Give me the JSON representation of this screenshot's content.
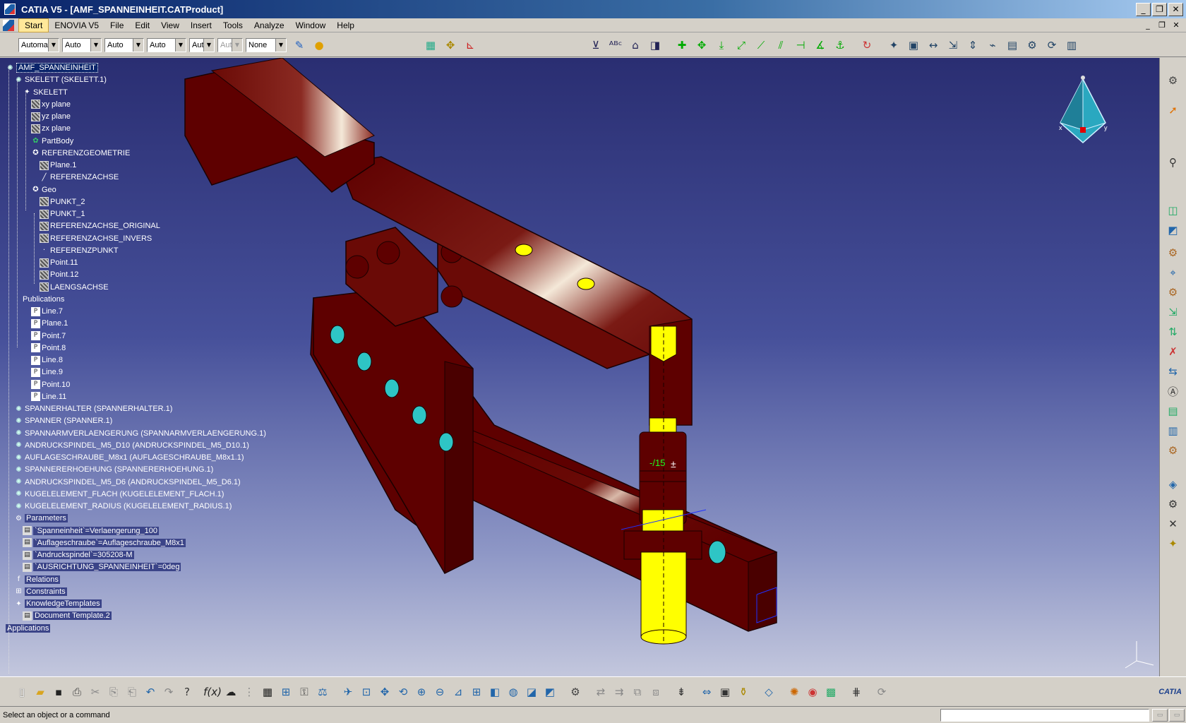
{
  "window": {
    "title": "CATIA V5 - [AMF_SPANNEINHEIT.CATProduct]",
    "minimize": "_",
    "restore": "❐",
    "close": "✕"
  },
  "menu": {
    "items": [
      "Start",
      "ENOVIA V5",
      "File",
      "Edit",
      "View",
      "Insert",
      "Tools",
      "Analyze",
      "Window",
      "Help"
    ],
    "active": "Start"
  },
  "toolbar_top": {
    "combos": [
      {
        "value": "Automa",
        "disabled": false
      },
      {
        "value": "Auto",
        "disabled": false
      },
      {
        "value": "Auto",
        "disabled": false
      },
      {
        "value": "Auto",
        "disabled": false
      },
      {
        "value": "Aut",
        "disabled": false
      },
      {
        "value": "Aut",
        "disabled": true
      },
      {
        "value": "None",
        "disabled": false
      }
    ]
  },
  "tree": {
    "nodes": [
      {
        "label": "AMF_SPANNEINHEIT",
        "level": 0,
        "icon": "product-icon",
        "style": "hl"
      },
      {
        "label": "SKELETT (SKELETT.1)",
        "level": 1,
        "icon": "product-icon"
      },
      {
        "label": "SKELETT",
        "level": 2,
        "icon": "part-icon"
      },
      {
        "label": "xy plane",
        "level": 3,
        "icon": "plane-icon"
      },
      {
        "label": "yz plane",
        "level": 3,
        "icon": "plane-icon"
      },
      {
        "label": "zx plane",
        "level": 3,
        "icon": "plane-icon"
      },
      {
        "label": "PartBody",
        "level": 3,
        "icon": "body-icon"
      },
      {
        "label": "REFERENZGEOMETRIE",
        "level": 3,
        "icon": "geoset-icon"
      },
      {
        "label": "Plane.1",
        "level": 4,
        "icon": "plane-icon"
      },
      {
        "label": "REFERENZACHSE",
        "level": 4,
        "icon": "line-icon"
      },
      {
        "label": "Geo",
        "level": 3,
        "icon": "geoset-icon"
      },
      {
        "label": "PUNKT_2",
        "level": 4,
        "icon": "plane-icon"
      },
      {
        "label": "PUNKT_1",
        "level": 4,
        "icon": "plane-icon"
      },
      {
        "label": "REFERENZACHSE_ORIGINAL",
        "level": 4,
        "icon": "plane-icon"
      },
      {
        "label": "REFERENZACHSE_INVERS",
        "level": 4,
        "icon": "plane-icon"
      },
      {
        "label": "REFERENZPUNKT",
        "level": 4,
        "icon": "point-icon"
      },
      {
        "label": "Point.11",
        "level": 4,
        "icon": "plane-icon"
      },
      {
        "label": "Point.12",
        "level": 4,
        "icon": "plane-icon"
      },
      {
        "label": "LAENGSACHSE",
        "level": 4,
        "icon": "plane-icon"
      },
      {
        "label": "Publications",
        "level": 2,
        "icon": "none"
      },
      {
        "label": "Line.7",
        "level": 3,
        "icon": "publication-icon"
      },
      {
        "label": "Plane.1",
        "level": 3,
        "icon": "publication-icon"
      },
      {
        "label": "Point.7",
        "level": 3,
        "icon": "publication-icon"
      },
      {
        "label": "Point.8",
        "level": 3,
        "icon": "publication-icon"
      },
      {
        "label": "Line.8",
        "level": 3,
        "icon": "publication-icon"
      },
      {
        "label": "Line.9",
        "level": 3,
        "icon": "publication-icon"
      },
      {
        "label": "Point.10",
        "level": 3,
        "icon": "publication-icon"
      },
      {
        "label": "Line.11",
        "level": 3,
        "icon": "publication-icon"
      },
      {
        "label": "SPANNERHALTER (SPANNERHALTER.1)",
        "level": 1,
        "icon": "product-icon"
      },
      {
        "label": "SPANNER (SPANNER.1)",
        "level": 1,
        "icon": "product-icon"
      },
      {
        "label": "SPANNARMVERLAENGERUNG (SPANNARMVERLAENGERUNG.1)",
        "level": 1,
        "icon": "product-icon"
      },
      {
        "label": "ANDRUCKSPINDEL_M5_D10 (ANDRUCKSPINDEL_M5_D10.1)",
        "level": 1,
        "icon": "product-icon"
      },
      {
        "label": "AUFLAGESCHRAUBE_M8x1 (AUFLAGESCHRAUBE_M8x1.1)",
        "level": 1,
        "icon": "product-icon"
      },
      {
        "label": "SPANNERERHOEHUNG (SPANNERERHOEHUNG.1)",
        "level": 1,
        "icon": "product-icon"
      },
      {
        "label": "ANDRUCKSPINDEL_M5_D6 (ANDRUCKSPINDEL_M5_D6.1)",
        "level": 1,
        "icon": "product-icon"
      },
      {
        "label": "KUGELELEMENT_FLACH (KUGELELEMENT_FLACH.1)",
        "level": 1,
        "icon": "product-icon"
      },
      {
        "label": "KUGELELEMENT_RADIUS (KUGELELEMENT_RADIUS.1)",
        "level": 1,
        "icon": "product-icon"
      },
      {
        "label": "Parameters",
        "level": 1,
        "icon": "parameters-icon",
        "style": "boxed"
      },
      {
        "label": "`Spanneinheit`=Verlaengerung_100",
        "level": 2,
        "icon": "parameter-icon",
        "style": "boxed"
      },
      {
        "label": "`Auflageschraube`=Auflageschraube_M8x1",
        "level": 2,
        "icon": "parameter-icon",
        "style": "boxed"
      },
      {
        "label": "`Andruckspindel`=305208-M",
        "level": 2,
        "icon": "parameter-icon",
        "style": "boxed"
      },
      {
        "label": "`AUSRICHTUNG_SPANNEINHEIT`=0deg",
        "level": 2,
        "icon": "parameter-icon",
        "style": "boxed"
      },
      {
        "label": "Relations",
        "level": 1,
        "icon": "relations-icon",
        "style": "boxed"
      },
      {
        "label": "Constraints",
        "level": 1,
        "icon": "constraints-icon",
        "style": "boxed"
      },
      {
        "label": "KnowledgeTemplates",
        "level": 1,
        "icon": "knowledge-icon",
        "style": "boxed"
      },
      {
        "label": "Document Template.2",
        "level": 2,
        "icon": "template-icon",
        "style": "boxed"
      },
      {
        "label": "Applications",
        "level": 0,
        "icon": "none",
        "style": "boxed"
      }
    ]
  },
  "model": {
    "dimension_label": "-/15",
    "tolerance_symbol": "±",
    "colors": {
      "body": "#5e0000",
      "body_light": "#7a1a14",
      "highlight": "#f4e8d8",
      "spindle": "#ffff00",
      "hole_cyan": "#2ec5c5",
      "edge": "#1a0000"
    }
  },
  "compass": {
    "labels": {
      "x": "x",
      "y": "y"
    }
  },
  "status": {
    "message": "Select an object or a command"
  },
  "logo": {
    "text": "CATIA"
  },
  "colors": {
    "title_bar_start": "#0a246a",
    "viewport_top": "#2a2e72",
    "viewport_bottom": "#c3c7dd",
    "chrome": "#d4d0c8"
  }
}
